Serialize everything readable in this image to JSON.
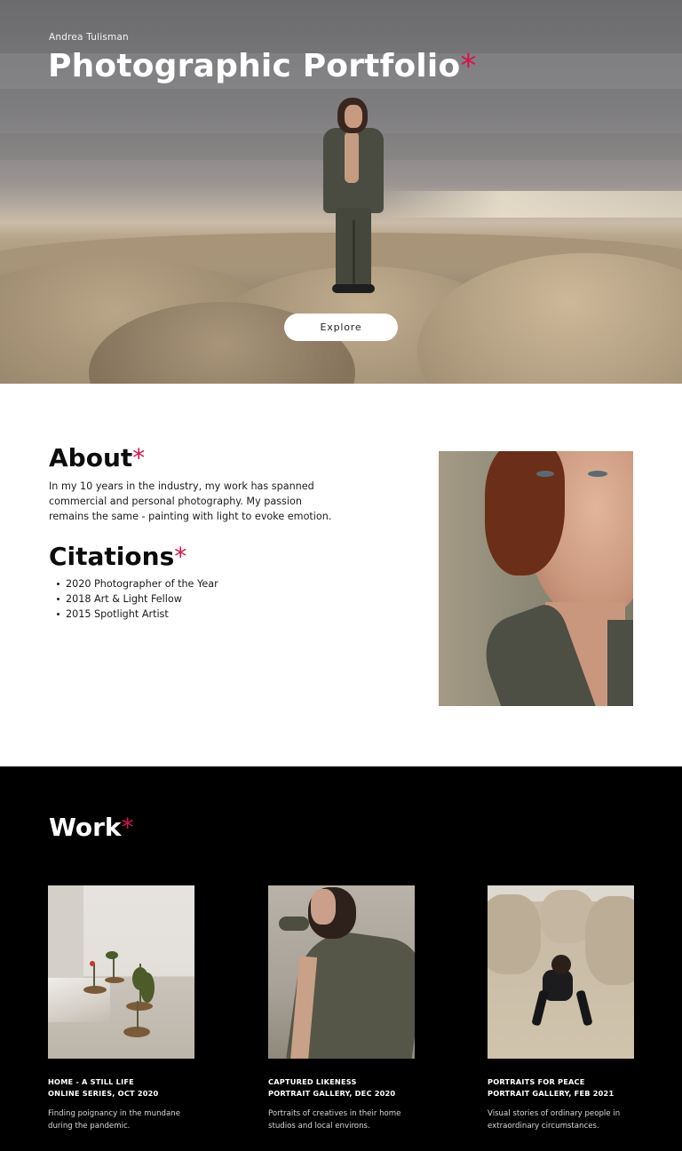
{
  "hero": {
    "author": "Andrea Tulisman",
    "title": "Photographic Portfolio",
    "asterisk": "*",
    "explore_label": "Explore"
  },
  "about": {
    "heading": "About",
    "text": "In my 10 years in the industry, my work has spanned commercial and personal photography. My passion remains the same - painting with light to evoke emotion.",
    "citations_heading": "Citations",
    "citations": [
      "2020 Photographer of the Year",
      "2018 Art & Light Fellow",
      "2015 Spotlight Artist"
    ]
  },
  "work": {
    "heading": "Work",
    "cards": [
      {
        "title_line1": "HOME - A STILL LIFE",
        "title_line2": "ONLINE SERIES, OCT 2020",
        "description": "Finding poignancy in the mundane during the pandemic."
      },
      {
        "title_line1": "CAPTURED LIKENESS",
        "title_line2": "PORTRAIT GALLERY, DEC 2020",
        "description": "Portraits of creatives in their home studios and local environs."
      },
      {
        "title_line1": "PORTRAITS FOR PEACE",
        "title_line2": "PORTRAIT GALLERY, FEB 2021",
        "description": " Visual stories of ordinary people in extraordinary circumstances."
      }
    ]
  },
  "colors": {
    "accent": "#d6124a",
    "work_background": "#000000",
    "about_background": "#ffffff"
  }
}
